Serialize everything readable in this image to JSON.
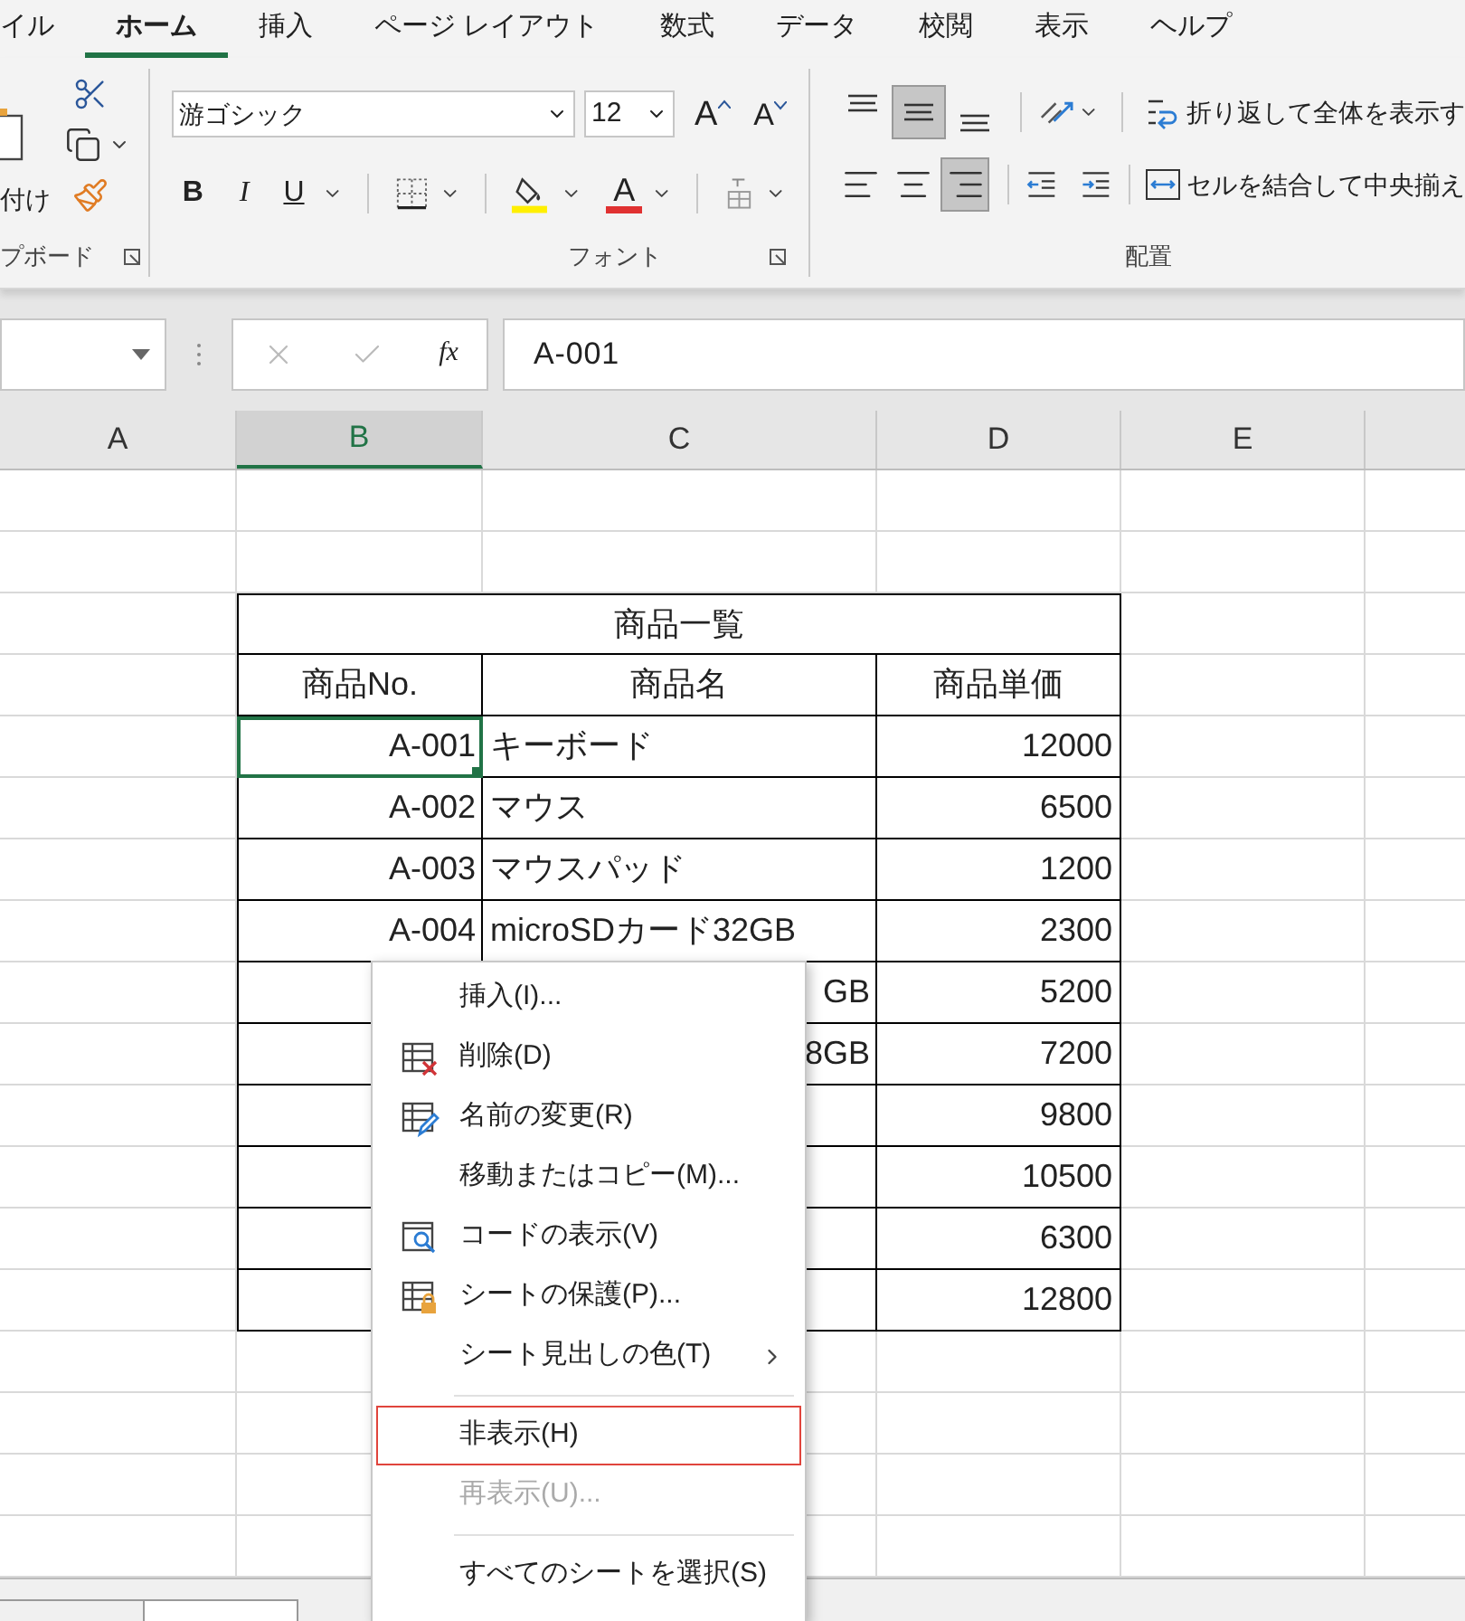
{
  "ribbon_tabs": [
    {
      "label": "イル",
      "selected": false
    },
    {
      "label": "ホーム",
      "selected": true
    },
    {
      "label": "挿入",
      "selected": false
    },
    {
      "label": "ページ レイアウト",
      "selected": false
    },
    {
      "label": "数式",
      "selected": false
    },
    {
      "label": "データ",
      "selected": false
    },
    {
      "label": "校閲",
      "selected": false
    },
    {
      "label": "表示",
      "selected": false
    },
    {
      "label": "ヘルプ",
      "selected": false
    }
  ],
  "clipboard": {
    "paste_label": "付け",
    "group_label": "プボード"
  },
  "font": {
    "name": "游ゴシック",
    "size": "12",
    "grow": "A",
    "shrink": "A",
    "bold": "B",
    "italic": "I",
    "underline": "U",
    "color_letter": "A",
    "group_label": "フォント"
  },
  "alignment": {
    "vertical": [
      {
        "kind": "top",
        "selected": false
      },
      {
        "kind": "middle",
        "selected": true
      },
      {
        "kind": "bottom",
        "selected": false
      }
    ],
    "horizontal": [
      {
        "kind": "left",
        "selected": false
      },
      {
        "kind": "center",
        "selected": false
      },
      {
        "kind": "right",
        "selected": true
      }
    ],
    "wrap_text": "折り返して全体を表示す",
    "merge": "セルを結合して中央揃え",
    "group_label": "配置"
  },
  "formula_bar": {
    "fx": "fx",
    "value": "A-001"
  },
  "columns": [
    {
      "label": "A",
      "selected": false
    },
    {
      "label": "B",
      "selected": true
    },
    {
      "label": "C",
      "selected": false
    },
    {
      "label": "D",
      "selected": false
    },
    {
      "label": "E",
      "selected": false
    }
  ],
  "table": {
    "title": "商品一覧",
    "headers": [
      "商品No.",
      "商品名",
      "商品単価"
    ],
    "rows": [
      {
        "no": "A-001",
        "name": "キーボード",
        "price": "12000",
        "selected": true
      },
      {
        "no": "A-002",
        "name": "マウス",
        "price": "6500",
        "selected": false
      },
      {
        "no": "A-003",
        "name": "マウスパッド",
        "price": "1200",
        "selected": false
      },
      {
        "no": "A-004",
        "name": "microSDカード32GB",
        "price": "2300",
        "selected": false
      },
      {
        "name": "GB",
        "price": "5200",
        "selected": false
      },
      {
        "name": "8GB",
        "price": "7200",
        "selected": false
      },
      {
        "price": "9800",
        "selected": false
      },
      {
        "price": "10500",
        "selected": false
      },
      {
        "price": "6300",
        "selected": false
      },
      {
        "price": "12800",
        "selected": false
      }
    ]
  },
  "context_menu": {
    "items": [
      {
        "kind": "item",
        "label": "挿入(I)...",
        "selected": false,
        "disabled": false
      },
      {
        "kind": "delete",
        "label": "削除(D)",
        "selected": false,
        "disabled": false
      },
      {
        "kind": "rename",
        "label": "名前の変更(R)",
        "selected": false,
        "disabled": false
      },
      {
        "kind": "item",
        "label": "移動またはコピー(M)...",
        "selected": false,
        "disabled": false
      },
      {
        "kind": "view-code",
        "label": "コードの表示(V)",
        "selected": false,
        "disabled": false
      },
      {
        "kind": "protect",
        "label": "シートの保護(P)...",
        "selected": false,
        "disabled": false
      },
      {
        "kind": "submenu",
        "label": "シート見出しの色(T)",
        "selected": false,
        "disabled": false
      },
      {
        "kind": "separator"
      },
      {
        "kind": "item",
        "label": "非表示(H)",
        "selected": true,
        "disabled": false
      },
      {
        "kind": "item",
        "label": "再表示(U)...",
        "selected": false,
        "disabled": true
      },
      {
        "kind": "separator"
      },
      {
        "kind": "item",
        "label": "すべてのシートを選択(S)",
        "selected": false,
        "disabled": false
      }
    ]
  }
}
